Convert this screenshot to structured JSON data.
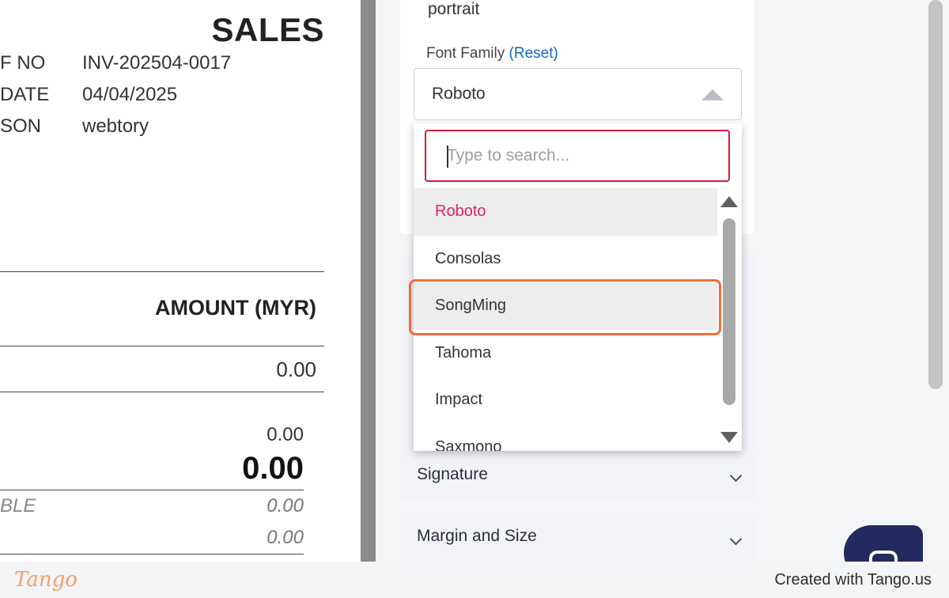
{
  "invoice": {
    "title": "SALES",
    "meta": [
      {
        "key": "F NO",
        "value": "INV-202504-0017"
      },
      {
        "key": "DATE",
        "value": "04/04/2025"
      },
      {
        "key": "SON",
        "value": "webtory"
      }
    ],
    "amount_header": "AMOUNT (MYR)",
    "row_amount": "0.00",
    "subtotal": "0.00",
    "total": "0.00",
    "partial_label": "BLE",
    "italic_amount_1": "0.00",
    "italic_amount_2": "0.00"
  },
  "settings": {
    "orientation_value": "portrait",
    "font_family_label": "Font Family",
    "font_family_reset": "(Reset)",
    "font_family_value": "Roboto",
    "sections": {
      "signature": "Signature",
      "margin_and_size": "Margin and Size"
    }
  },
  "dropdown": {
    "search_placeholder": "Type to search...",
    "options": [
      "Roboto",
      "Consolas",
      "SongMing",
      "Tahoma",
      "Impact",
      "Saxmono"
    ],
    "selected": "Roboto",
    "highlighted": "SongMing"
  },
  "colors": {
    "selected_option": "#e0245e",
    "search_border": "#d81b3c",
    "highlight_outline": "#f26b3a",
    "reset_link": "#1565c0",
    "chat_bubble": "#222a5e",
    "brand_logo": "#f59e6b"
  },
  "icons": {
    "dropdown_toggle": "caret-up-icon",
    "section_expand": "chevron-down-icon",
    "chat": "chat-icon"
  },
  "footer": {
    "logo": "Tango",
    "credit": "Created with Tango.us"
  }
}
